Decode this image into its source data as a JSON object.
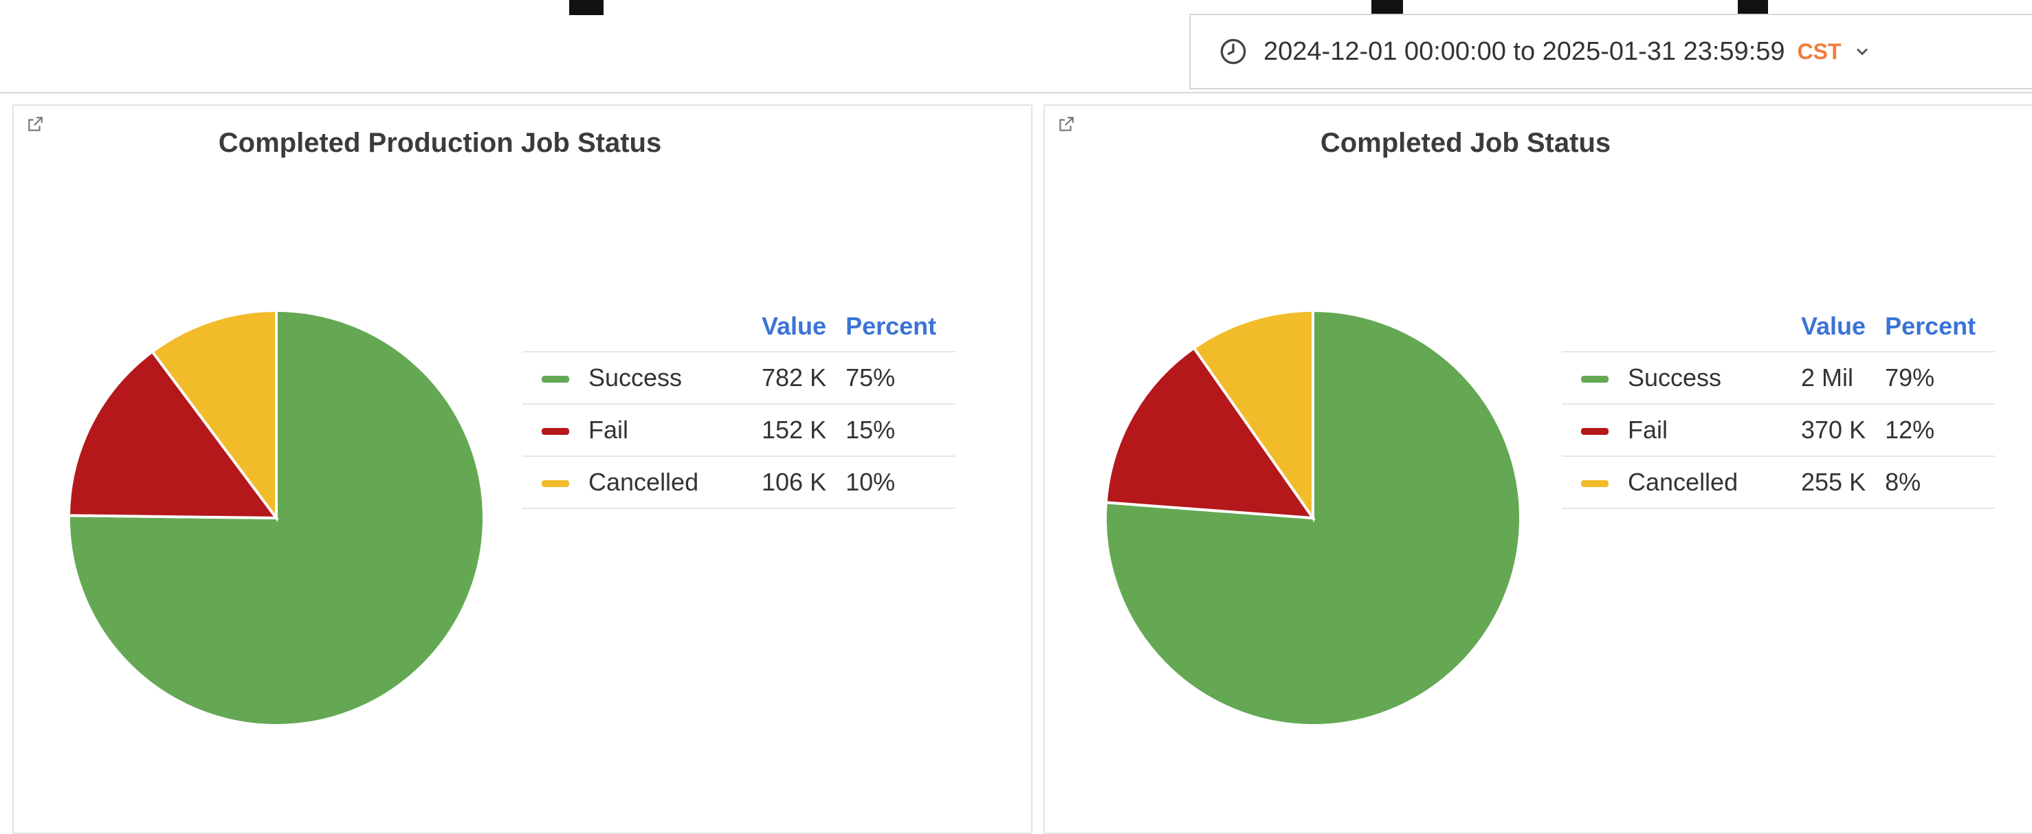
{
  "time_range": {
    "text": "2024-12-01 00:00:00 to 2025-01-31 23:59:59",
    "timezone": "CST",
    "clock_icon": "clock-icon",
    "dropdown_icon": "chevron-down-icon"
  },
  "colors": {
    "success": "#64a854",
    "fail": "#b4181b",
    "cancelled": "#f2bb2a",
    "header": "#3b73d6",
    "timezone": "#f07c3a"
  },
  "legend_headers": {
    "value": "Value",
    "percent": "Percent"
  },
  "chart_data": [
    {
      "type": "pie",
      "title": "Completed Production Job Status",
      "labels": [
        "Success",
        "Fail",
        "Cancelled"
      ],
      "values": [
        782000,
        152000,
        106000
      ],
      "value_labels": [
        "782 K",
        "152 K",
        "106 K"
      ],
      "percent_labels": [
        "75%",
        "15%",
        "10%"
      ],
      "legend_placement": "right"
    },
    {
      "type": "pie",
      "title": "Completed Job Status",
      "labels": [
        "Success",
        "Fail",
        "Cancelled"
      ],
      "values": [
        2000000,
        370000,
        255000
      ],
      "value_labels": [
        "2 Mil",
        "370 K",
        "255 K"
      ],
      "percent_labels": [
        "79%",
        "12%",
        "8%"
      ],
      "legend_placement": "right"
    }
  ]
}
